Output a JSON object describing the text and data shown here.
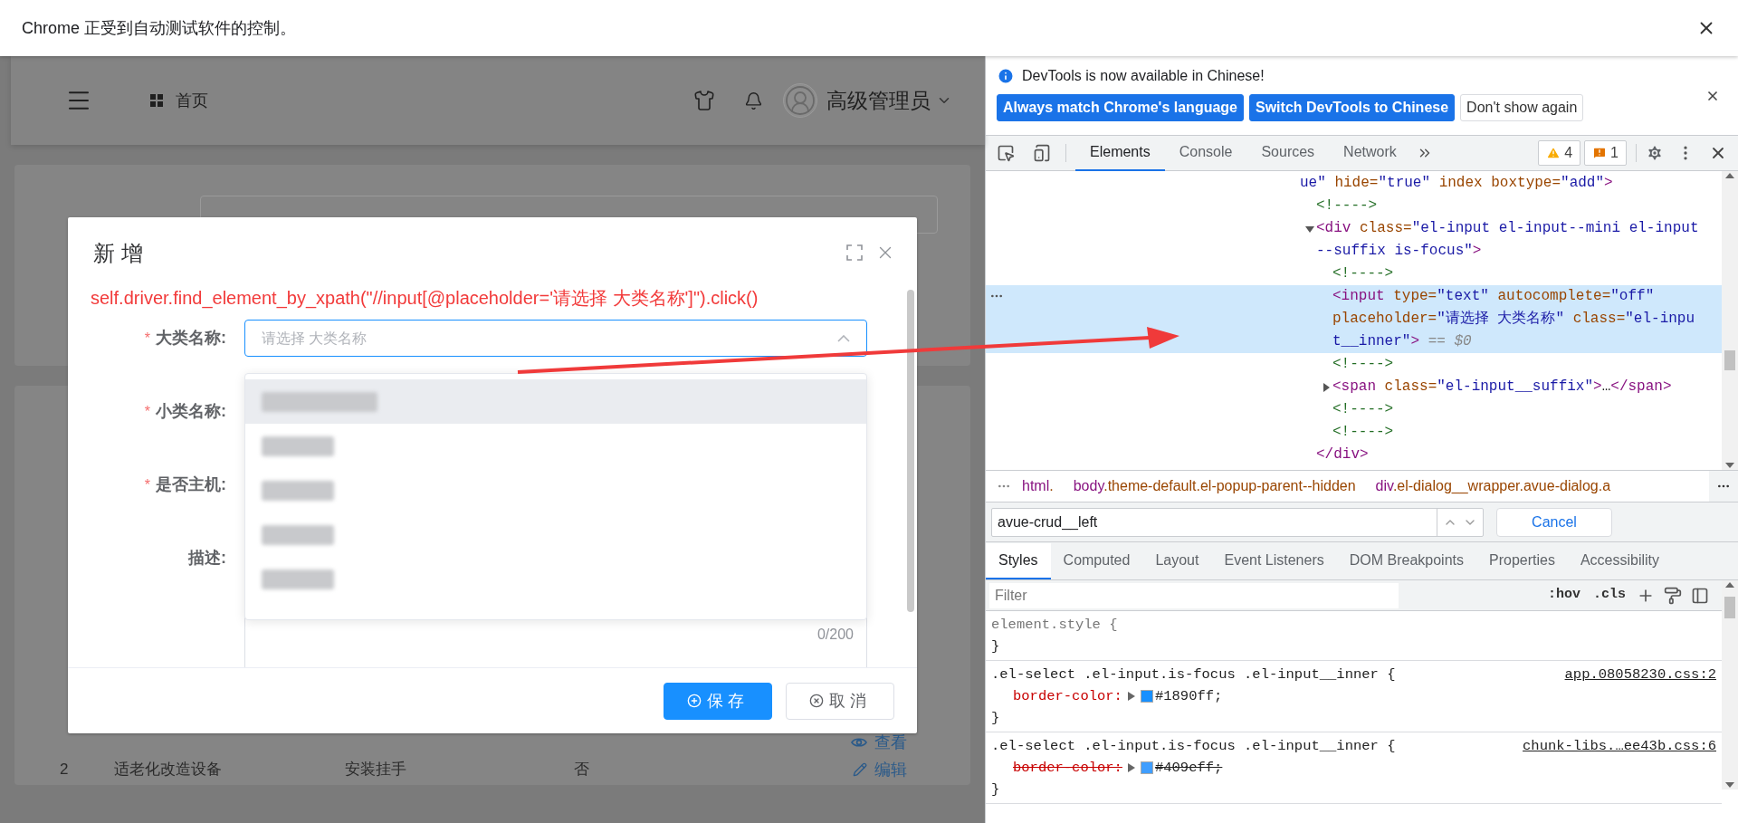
{
  "automation_bar": {
    "message": "Chrome 正受到自动测试软件的控制。"
  },
  "page": {
    "header": {
      "breadcrumb": "首页",
      "user": "高级管理员"
    },
    "table": {
      "rows": [
        {
          "action": {
            "kind": "view",
            "label": "查看"
          }
        },
        {
          "cells": [
            "2",
            "适老化改造设备",
            "安装挂手",
            "否"
          ],
          "action": {
            "kind": "edit",
            "label": "编辑"
          }
        }
      ]
    }
  },
  "dialog": {
    "title": "新 增",
    "annotation": "self.driver.find_element_by_xpath(\"//input[@placeholder='请选择 大类名称']\").click()",
    "fields": [
      {
        "mark": "*",
        "label": "大类名称:",
        "kind": "select",
        "placeholder": "请选择 大类名称",
        "focused": true,
        "open": true,
        "options": [
          {
            "highlighted": true
          },
          {
            "highlighted": false
          },
          {
            "highlighted": false
          },
          {
            "highlighted": false
          },
          {
            "highlighted": false
          }
        ]
      },
      {
        "mark": "*",
        "label": "小类名称:",
        "kind": "hidden"
      },
      {
        "mark": "*",
        "label": "是否主机:",
        "kind": "hidden"
      },
      {
        "label": "描述:",
        "kind": "textarea",
        "counter": "0/200"
      }
    ],
    "buttons": [
      {
        "kind": "primary",
        "label": "保存"
      },
      {
        "kind": "default",
        "label": "取消"
      }
    ]
  },
  "devtools": {
    "infobar": {
      "message": "DevTools is now available in Chinese!",
      "buttons": [
        {
          "kind": "primary",
          "label": "Always match Chrome's language"
        },
        {
          "kind": "primary",
          "label": "Switch DevTools to Chinese"
        },
        {
          "kind": "secondary",
          "label": "Don't show again"
        }
      ]
    },
    "tabs": [
      {
        "label": "Elements",
        "selected": true
      },
      {
        "label": "Console",
        "selected": false
      },
      {
        "label": "Sources",
        "selected": false
      },
      {
        "label": "Network",
        "selected": false
      }
    ],
    "counters": [
      {
        "kind": "warning",
        "count": "4"
      },
      {
        "kind": "issue",
        "count": "1"
      }
    ],
    "tree": {
      "selected": false,
      "lines": [
        [
          {
            "kind": "value",
            "text": "ue\""
          },
          {
            "kind": "attr",
            "text": " hide="
          },
          {
            "kind": "value",
            "text": "\"true\""
          },
          {
            "kind": "attr",
            "text": " index boxtype="
          },
          {
            "kind": "value",
            "text": "\"add\""
          },
          {
            "kind": "tag",
            "text": ">"
          }
        ]
      ],
      "children": [
        {
          "selected": false,
          "lines": [
            [
              {
                "kind": "comment",
                "text": "<!---->"
              }
            ]
          ]
        },
        {
          "selected": false,
          "expanded": true,
          "lines": [
            [
              {
                "kind": "tag",
                "text": "<div"
              },
              {
                "kind": "attr",
                "text": " class="
              },
              {
                "kind": "value",
                "text": "\"el-input el-input--mini el-input"
              }
            ],
            [
              {
                "kind": "value",
                "text": "--suffix is-focus\""
              },
              {
                "kind": "tag",
                "text": ">"
              }
            ]
          ],
          "children": [
            {
              "selected": false,
              "lines": [
                [
                  {
                    "kind": "comment",
                    "text": "<!---->"
                  }
                ]
              ]
            },
            {
              "selected": true,
              "lines": [
                [
                  {
                    "kind": "tag",
                    "text": "<input"
                  },
                  {
                    "kind": "attr",
                    "text": " type="
                  },
                  {
                    "kind": "value",
                    "text": "\"text\""
                  },
                  {
                    "kind": "attr",
                    "text": " autocomplete="
                  },
                  {
                    "kind": "value",
                    "text": "\"off\""
                  }
                ],
                [
                  {
                    "kind": "attr",
                    "text": "placeholder="
                  },
                  {
                    "kind": "value",
                    "text": "\"请选择 大类名称\""
                  },
                  {
                    "kind": "attr",
                    "text": " class="
                  },
                  {
                    "kind": "value",
                    "text": "\"el-inpu"
                  }
                ],
                [
                  {
                    "kind": "value",
                    "text": "t__inner\""
                  },
                  {
                    "kind": "tag",
                    "text": ">"
                  },
                  {
                    "kind": "dim",
                    "text": " == $0"
                  }
                ]
              ]
            },
            {
              "selected": false,
              "lines": [
                [
                  {
                    "kind": "comment",
                    "text": "<!---->"
                  }
                ]
              ]
            },
            {
              "selected": false,
              "expanded": false,
              "lines": [
                [
                  {
                    "kind": "tag",
                    "text": "<span"
                  },
                  {
                    "kind": "attr",
                    "text": " class="
                  },
                  {
                    "kind": "value",
                    "text": "\"el-input__suffix\""
                  },
                  {
                    "kind": "tag",
                    "text": ">"
                  },
                  {
                    "kind": "plain",
                    "text": "…"
                  },
                  {
                    "kind": "tag",
                    "text": "</span>"
                  }
                ]
              ]
            },
            {
              "selected": false,
              "lines": [
                [
                  {
                    "kind": "comment",
                    "text": "<!---->"
                  }
                ]
              ]
            },
            {
              "selected": false,
              "lines": [
                [
                  {
                    "kind": "comment",
                    "text": "<!---->"
                  }
                ]
              ]
            }
          ],
          "close": [
            [
              {
                "kind": "tag",
                "text": "</div>"
              }
            ]
          ]
        }
      ]
    },
    "breadcrumbs": [
      {
        "tag": "html",
        "cls": "."
      },
      {
        "tag": "body",
        "cls": ".theme-default.el-popup-parent--hidden"
      },
      {
        "tag": "div",
        "cls": ".el-dialog__wrapper.avue-dialog.a"
      }
    ],
    "search": {
      "value": "avue-crud__left",
      "cancel": "Cancel"
    },
    "sidebar_tabs": [
      {
        "label": "Styles",
        "selected": true
      },
      {
        "label": "Computed",
        "selected": false
      },
      {
        "label": "Layout",
        "selected": false
      },
      {
        "label": "Event Listeners",
        "selected": false
      },
      {
        "label": "DOM Breakpoints",
        "selected": false
      },
      {
        "label": "Properties",
        "selected": false
      },
      {
        "label": "Accessibility",
        "selected": false
      }
    ],
    "filter": {
      "placeholder": "Filter",
      "toggles": [
        ":hov",
        ".cls"
      ]
    },
    "rules": [
      {
        "kind": "inline",
        "selector": "element.style {",
        "close": "}"
      },
      {
        "kind": "rule",
        "selector": ".el-select .el-input.is-focus .el-input__inner {",
        "source": "app.08058230.css:2",
        "close": "}",
        "properties": [
          {
            "name": "border-color:",
            "value": "#1890ff;",
            "color": "#1890ff",
            "overridden": false
          }
        ]
      },
      {
        "kind": "rule",
        "selector": ".el-select .el-input.is-focus .el-input__inner {",
        "source": "chunk-libs.…ee43b.css:6",
        "close": "}",
        "properties": [
          {
            "name": "border-color:",
            "value": "#409eff;",
            "color": "#409eff",
            "overridden": true
          }
        ]
      }
    ]
  }
}
